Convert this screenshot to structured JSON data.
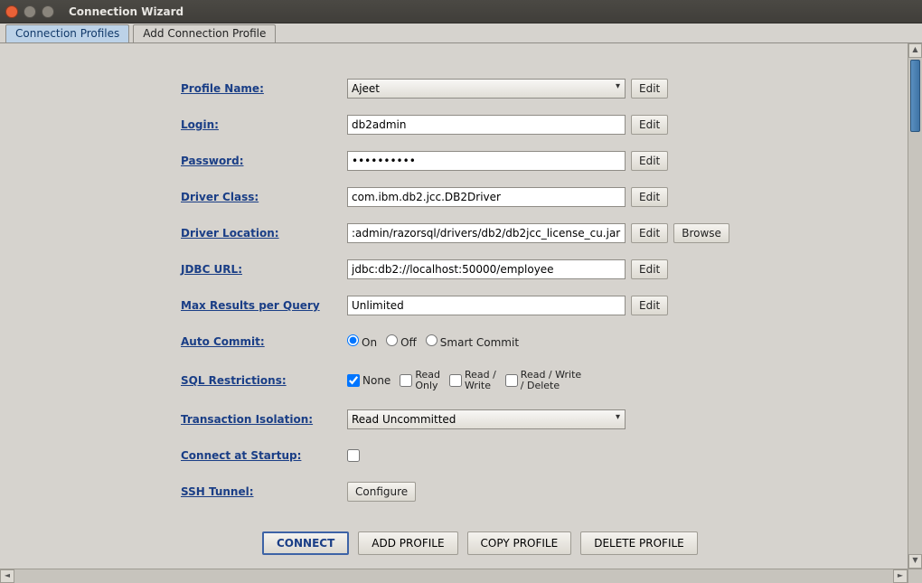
{
  "window": {
    "title": "Connection Wizard"
  },
  "tabs": {
    "profiles": "Connection Profiles",
    "add": "Add Connection Profile"
  },
  "labels": {
    "profile_name": "Profile Name:",
    "login": "Login:",
    "password": "Password:",
    "driver_class": "Driver Class:",
    "driver_location": "Driver Location:",
    "jdbc_url": "JDBC URL:",
    "max_results": "Max Results per Query",
    "auto_commit": "Auto Commit:",
    "sql_restrictions": "SQL Restrictions:",
    "transaction_isolation": "Transaction Isolation:",
    "connect_startup": "Connect at Startup:",
    "ssh_tunnel": "SSH Tunnel:"
  },
  "values": {
    "profile_name": "Ajeet",
    "login": "db2admin",
    "password": "••••••••••",
    "driver_class": "com.ibm.db2.jcc.DB2Driver",
    "driver_location": ":admin/razorsql/drivers/db2/db2jcc_license_cu.jar",
    "jdbc_url": "jdbc:db2://localhost:50000/employee",
    "max_results": "Unlimited",
    "transaction_isolation": "Read Uncommitted"
  },
  "auto_commit": {
    "on": "On",
    "off": "Off",
    "smart": "Smart Commit",
    "selected": "on"
  },
  "sql_restrictions": {
    "none": "None",
    "read_only_l1": "Read",
    "read_only_l2": "Only",
    "read_write_l1": "Read /",
    "read_write_l2": "Write",
    "rwd_l1": "Read / Write",
    "rwd_l2": "/ Delete",
    "none_checked": true
  },
  "buttons": {
    "edit": "Edit",
    "browse": "Browse",
    "configure": "Configure",
    "connect": "CONNECT",
    "add_profile": "ADD PROFILE",
    "copy_profile": "COPY PROFILE",
    "delete_profile": "DELETE PROFILE"
  }
}
